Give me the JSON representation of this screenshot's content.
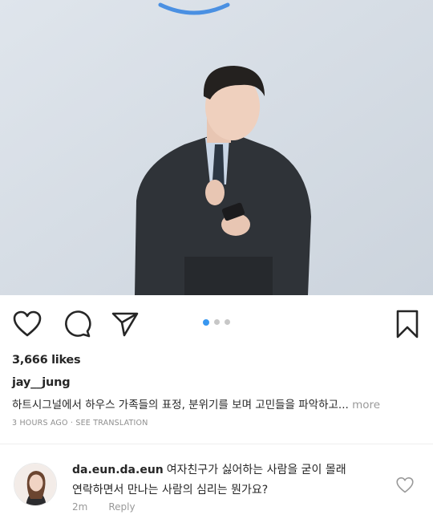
{
  "post": {
    "likes": "3,666 likes",
    "username": "jay__jung",
    "caption": "하트시그널에서 하우스 가족들의 표정, 분위기를 보며 고민들을 파악하고...",
    "more_label": " more",
    "time_ago": "3 HOURS AGO",
    "separator": " · ",
    "see_translation": "SEE TRANSLATION"
  },
  "carousel": {
    "count": 3,
    "active_index": 0
  },
  "actions": {
    "like_icon": "heart-outline-icon",
    "comment_icon": "comment-bubble-icon",
    "share_icon": "paper-plane-icon",
    "save_icon": "bookmark-outline-icon"
  },
  "comment": {
    "username": "da.eun.da.eun",
    "text_line1": "여자친구가 싫어하는 사람을 굳이 몰래",
    "text_line2": "연락하면서 만나는 사람의 심리는 뭔가요?",
    "time": "2m",
    "reply_label": "Reply"
  },
  "colors": {
    "accent_blue": "#3897f0",
    "dot_inactive": "#c7c7c7",
    "text_primary": "#262626",
    "text_secondary": "#8e8e8e"
  }
}
